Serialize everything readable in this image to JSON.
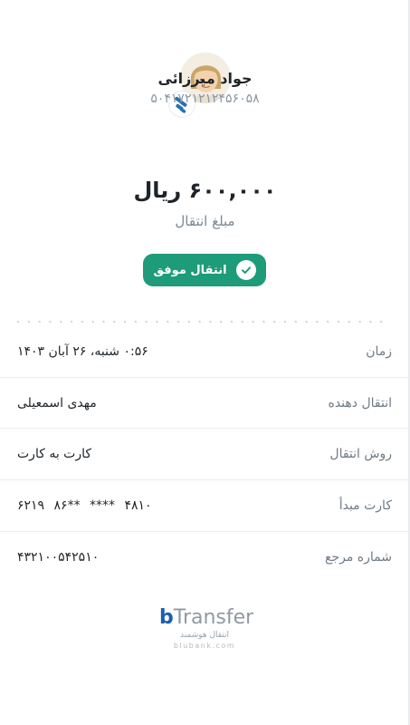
{
  "recipient": {
    "name": "جواد میرزائی",
    "account": "۵۰۴۱۷۲۱۲۱۲۴۵۶۰۵۸"
  },
  "amount": {
    "value": "۶۰۰,۰۰۰ ریال",
    "label": "مبلغ انتقال"
  },
  "status": {
    "label": "انتقال موفق"
  },
  "details": [
    {
      "label": "زمان",
      "value": "۰:۵۶ شنبه، ۲۶ آبان ۱۴۰۳"
    },
    {
      "label": "انتقال دهنده",
      "value": "مهدی اسمعیلی"
    },
    {
      "label": "روش انتقال",
      "value": "کارت به کارت"
    },
    {
      "label": "کارت مبدأ",
      "value": "۶۲۱۹ ۸۶** **** ۴۸۱۰"
    },
    {
      "label": "شماره مرجع",
      "value": "۴۳۲۱۰۰۵۴۲۵۱۰"
    }
  ],
  "footer_logo": {
    "brand_b": "b",
    "brand_rest": "Transfer",
    "tagline": "انتقال هوشمند",
    "site": "blubank.com"
  },
  "colors": {
    "success": "#1e9b79",
    "brand_blue": "#1b5fae",
    "label_gray": "#6f7a86",
    "text_dark": "#1f2429"
  },
  "icons": {
    "avatar": "person-avatar",
    "bank_badge": "bank-logo-icon",
    "status": "checkmark-icon"
  }
}
